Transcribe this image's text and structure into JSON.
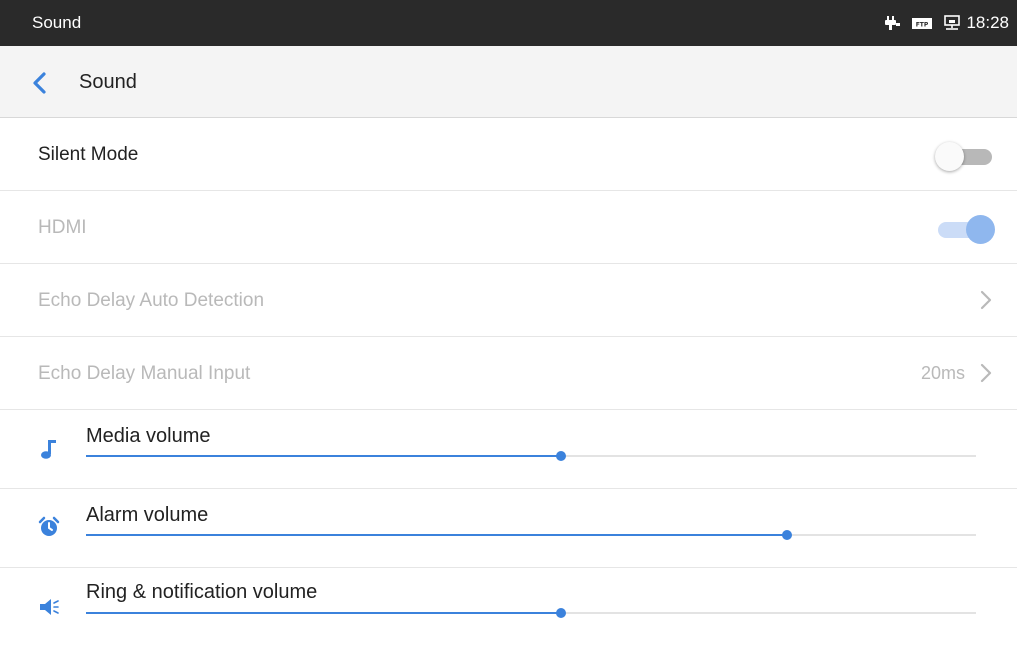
{
  "status_bar": {
    "title": "Sound",
    "time": "18:28",
    "icons": [
      "poe-power-icon",
      "ftp-icon",
      "ethernet-icon"
    ]
  },
  "app_bar": {
    "title": "Sound",
    "back_icon": "back-arrow-icon"
  },
  "settings": {
    "silent_mode": {
      "label": "Silent Mode",
      "enabled": true,
      "checked": false
    },
    "hdmi": {
      "label": "HDMI",
      "enabled": false,
      "checked": true
    },
    "echo_auto": {
      "label": "Echo Delay Auto Detection",
      "enabled": false
    },
    "echo_manual": {
      "label": "Echo Delay Manual Input",
      "value": "20ms",
      "enabled": false
    }
  },
  "volumes": {
    "media": {
      "label": "Media volume",
      "icon": "music-note-icon",
      "level": 0.534
    },
    "alarm": {
      "label": "Alarm volume",
      "icon": "alarm-clock-icon",
      "level": 0.788
    },
    "ring": {
      "label": "Ring & notification volume",
      "icon": "speaker-icon",
      "level": 0.534
    }
  },
  "colors": {
    "accent": "#3b82dc",
    "status_bar_bg": "#2a2a2a",
    "app_bar_bg": "#f4f4f4",
    "disabled_text": "#b9b9b9"
  }
}
